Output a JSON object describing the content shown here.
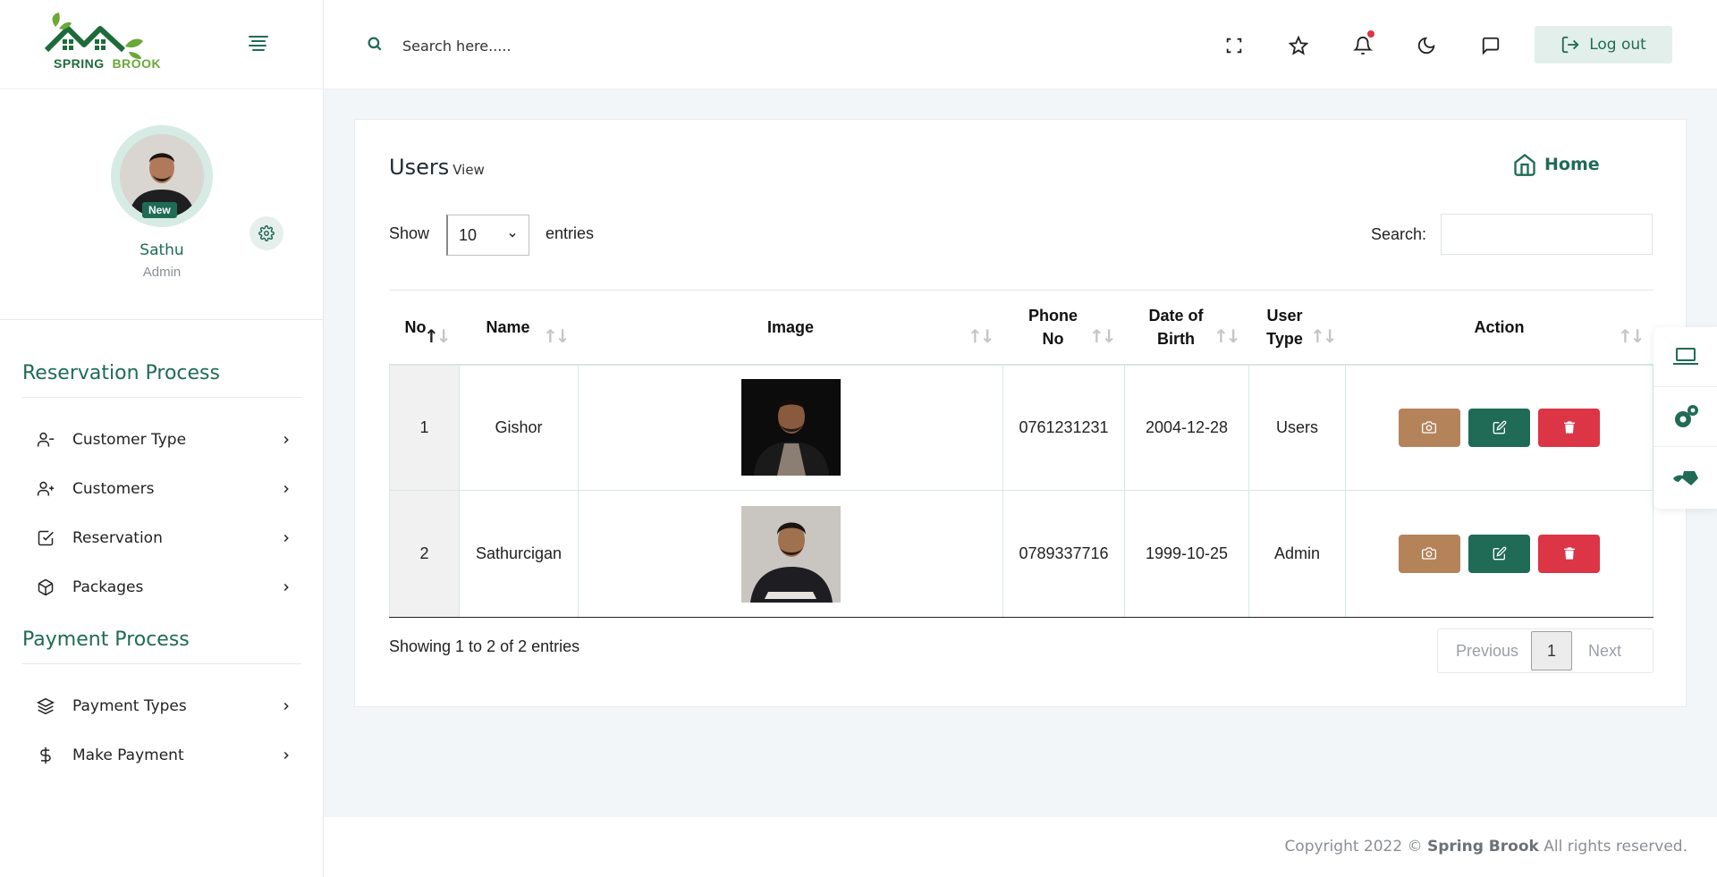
{
  "brand": {
    "name_part1": "SPRING",
    "name_part2": "BROOK",
    "primary_color": "#1f6b55",
    "accent_green": "#6aa838"
  },
  "profile": {
    "name": "Sathu",
    "role": "Admin",
    "badge": "New"
  },
  "sidebar": {
    "sections": [
      {
        "title": "Reservation Process"
      },
      {
        "title": "Payment Process"
      }
    ],
    "items": [
      {
        "label": "Customer Type",
        "icon": "user-minus-icon"
      },
      {
        "label": "Customers",
        "icon": "user-plus-icon"
      },
      {
        "label": "Reservation",
        "icon": "check-square-icon"
      },
      {
        "label": "Packages",
        "icon": "package-icon"
      },
      {
        "label": "Payment Types",
        "icon": "layers-icon"
      },
      {
        "label": "Make Payment",
        "icon": "dollar-icon"
      }
    ]
  },
  "topbar": {
    "search_placeholder": "Search here.....",
    "logout_label": "Log out"
  },
  "page": {
    "title": "Users",
    "subtitle": "View",
    "home_label": "Home",
    "show_label": "Show",
    "entries_value": "10",
    "entries_label": "entries",
    "search_label": "Search:",
    "showing_text": "Showing 1 to 2 of 2 entries",
    "pager": {
      "previous": "Previous",
      "current": "1",
      "next": "Next"
    }
  },
  "table": {
    "headers": {
      "no": "No",
      "name": "Name",
      "image": "Image",
      "phone_1": "Phone",
      "phone_2": "No",
      "dob_1": "Date of",
      "dob_2": "Birth",
      "type_1": "User",
      "type_2": "Type",
      "action": "Action"
    },
    "rows": [
      {
        "no": "1",
        "name": "Gishor",
        "phone": "0761231231",
        "dob": "2004-12-28",
        "type": "Users"
      },
      {
        "no": "2",
        "name": "Sathurcigan",
        "phone": "0789337716",
        "dob": "1999-10-25",
        "type": "Admin"
      }
    ]
  },
  "footer": {
    "prefix": "Copyright 2022 ©",
    "brand": "Spring Brook",
    "suffix": "All rights reserved."
  }
}
